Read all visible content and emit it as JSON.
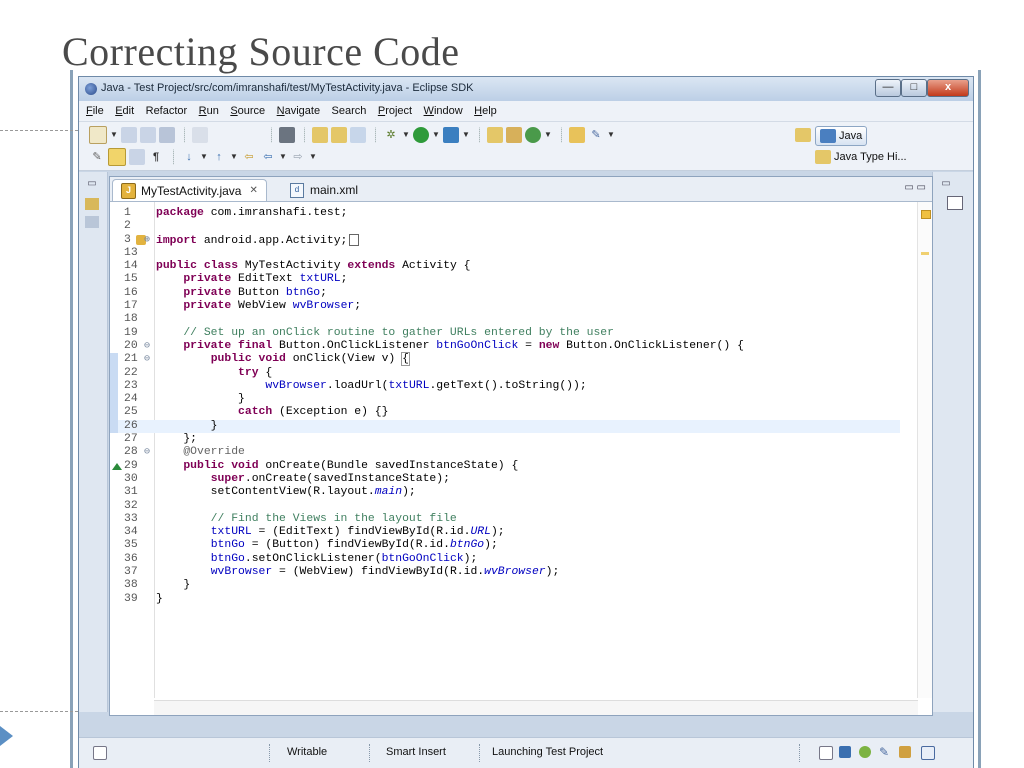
{
  "slide": {
    "title": "Correcting Source Code"
  },
  "window": {
    "title": "Java - Test Project/src/com/imranshafi/test/MyTestActivity.java - Eclipse SDK",
    "controls": {
      "minimize": "—",
      "maximize": "□",
      "close": "x"
    }
  },
  "menu": [
    {
      "first": "F",
      "rest": "ile"
    },
    {
      "first": "E",
      "rest": "dit"
    },
    {
      "first": "",
      "rest": "Refactor"
    },
    {
      "first": "R",
      "rest": "un"
    },
    {
      "first": "S",
      "rest": "ource"
    },
    {
      "first": "N",
      "rest": "avigate"
    },
    {
      "first": "",
      "rest": "Search"
    },
    {
      "first": "P",
      "rest": "roject"
    },
    {
      "first": "W",
      "rest": "indow"
    },
    {
      "first": "H",
      "rest": "elp"
    }
  ],
  "perspectives": {
    "java": "Java",
    "java_type": "Java Type Hi..."
  },
  "tabs": {
    "active": "MyTestActivity.java",
    "close": "✕",
    "other": "main.xml"
  },
  "code": [
    {
      "n": "1",
      "t": "package com.imranshafi.test;"
    },
    {
      "n": "2",
      "t": ""
    },
    {
      "n": "3",
      "t": "import android.app.Activity;"
    },
    {
      "n": "13",
      "t": ""
    },
    {
      "n": "14",
      "t": "public class MyTestActivity extends Activity {"
    },
    {
      "n": "15",
      "t": "    private EditText txtURL;"
    },
    {
      "n": "16",
      "t": "    private Button btnGo;"
    },
    {
      "n": "17",
      "t": "    private WebView wvBrowser;"
    },
    {
      "n": "18",
      "t": ""
    },
    {
      "n": "19",
      "t": "    // Set up an onClick routine to gather URLs entered by the user"
    },
    {
      "n": "20",
      "t": "    private final Button.OnClickListener btnGoOnClick = new Button.OnClickListener() {"
    },
    {
      "n": "21",
      "t": "        public void onClick(View v) {"
    },
    {
      "n": "22",
      "t": "            try {"
    },
    {
      "n": "23",
      "t": "                wvBrowser.loadUrl(txtURL.getText().toString());"
    },
    {
      "n": "24",
      "t": "            }"
    },
    {
      "n": "25",
      "t": "            catch (Exception e) {}"
    },
    {
      "n": "26",
      "t": "        }"
    },
    {
      "n": "27",
      "t": "    };"
    },
    {
      "n": "28",
      "t": "    @Override"
    },
    {
      "n": "29",
      "t": "    public void onCreate(Bundle savedInstanceState) {"
    },
    {
      "n": "30",
      "t": "        super.onCreate(savedInstanceState);"
    },
    {
      "n": "31",
      "t": "        setContentView(R.layout.main);"
    },
    {
      "n": "32",
      "t": ""
    },
    {
      "n": "33",
      "t": "        // Find the Views in the layout file"
    },
    {
      "n": "34",
      "t": "        txtURL = (EditText) findViewById(R.id.URL);"
    },
    {
      "n": "35",
      "t": "        btnGo = (Button) findViewById(R.id.btnGo);"
    },
    {
      "n": "36",
      "t": "        btnGo.setOnClickListener(btnGoOnClick);"
    },
    {
      "n": "37",
      "t": "        wvBrowser = (WebView) findViewById(R.id.wvBrowser);"
    },
    {
      "n": "38",
      "t": "    }"
    },
    {
      "n": "39",
      "t": "}"
    }
  ],
  "status": {
    "writable": "Writable",
    "insert_mode": "Smart Insert",
    "message": "Launching Test Project"
  },
  "colors": {
    "keyword": "#7f0055",
    "field": "#0000c0",
    "comment": "#3f7f5f",
    "current_line": "#e8f2fe"
  }
}
